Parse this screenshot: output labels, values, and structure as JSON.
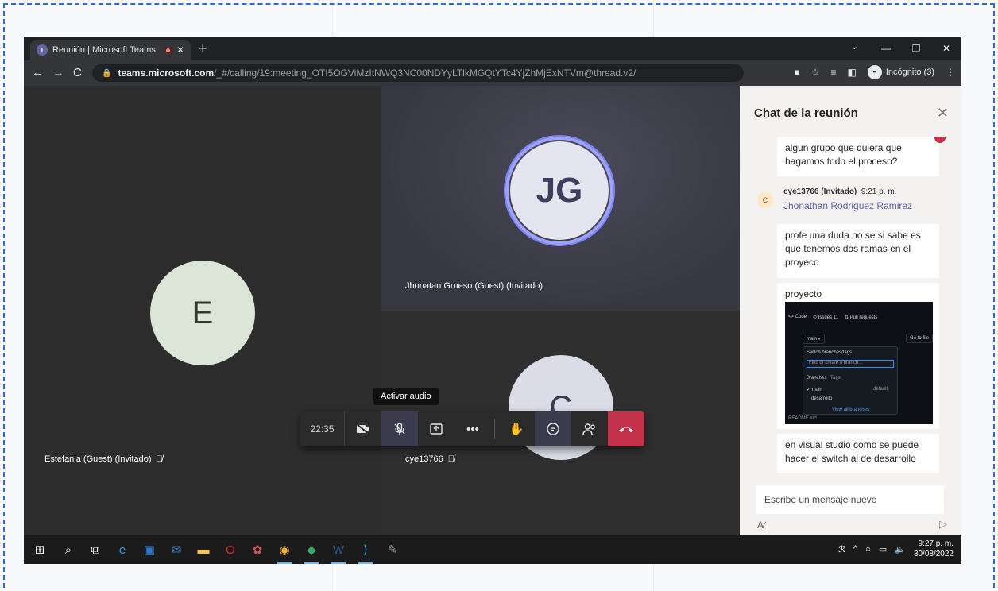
{
  "browser": {
    "tab_title": "Reunión | Microsoft Teams",
    "url_host": "teams.microsoft.com",
    "url_path": "/_#/calling/19:meeting_OTI5OGViMzItNWQ3NC00NDYyLTlkMGQtYTc4YjZhMjExNTVm@thread.v2/",
    "incognito_label": "Incógnito (3)"
  },
  "meeting": {
    "participants": [
      {
        "initials": "E",
        "name": "Estefania (Guest) (Invitado)"
      },
      {
        "initials": "JG",
        "name": "Jhonatan Grueso (Guest) (Invitado)"
      },
      {
        "initials": "C",
        "name": "cye13766"
      }
    ],
    "tooltip": "Activar audio",
    "toolbar": {
      "time": "22:35"
    }
  },
  "chat": {
    "title": "Chat de la reunión",
    "messages": [
      {
        "text": "algun grupo que quiera que hagamos todo el proceso?"
      },
      {
        "author": "cye13766 (Invitado)",
        "time": "9:21 p. m.",
        "mention": "Jhonathan Rodriguez Ramirez",
        "avatar": "C"
      },
      {
        "text": "profe una duda no se si sabe es que tenemos dos ramas en el proyeco"
      },
      {
        "text": "proyecto"
      },
      {
        "text": "en visual studio como se puede hacer el switch al de desarrollo"
      }
    ],
    "screenshot": {
      "tabs": [
        "<> Code",
        "⊙ Issues 11",
        "⇅ Pull requests"
      ],
      "branch": "main ▾",
      "goto": "Go to file",
      "popup_title": "Switch branches/tags",
      "popup_placeholder": "Find or create a branch…",
      "popup_tabs": [
        "Branches",
        "Tags"
      ],
      "branches": [
        "main",
        "desarrollo"
      ],
      "default_label": "default",
      "view_all": "View all branches",
      "readme": "README.md"
    },
    "compose_placeholder": "Escribe un mensaje nuevo"
  },
  "taskbar": {
    "time": "9:27 p. m.",
    "date": "30/08/2022"
  }
}
